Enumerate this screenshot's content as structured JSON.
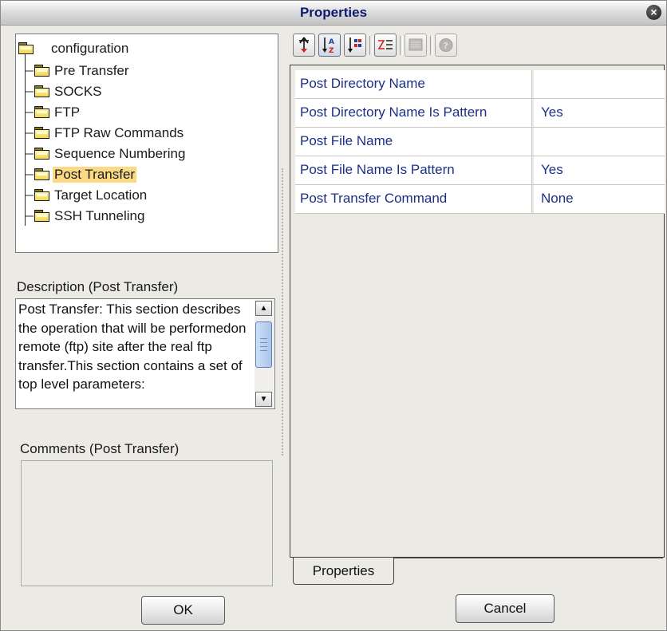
{
  "window": {
    "title": "Properties",
    "close_icon": "close-icon"
  },
  "tree": {
    "root": "configuration",
    "items": [
      {
        "label": "Pre Transfer"
      },
      {
        "label": "SOCKS"
      },
      {
        "label": "FTP"
      },
      {
        "label": "FTP Raw Commands"
      },
      {
        "label": "Sequence Numbering"
      },
      {
        "label": "Post Transfer",
        "selected": true
      },
      {
        "label": "Target Location"
      },
      {
        "label": "SSH Tunneling"
      }
    ]
  },
  "description": {
    "label": "Description (Post Transfer)",
    "text": "Post Transfer: This section describes the operation that will be performedon remote (ftp) site after the real ftp transfer.This section contains a set of top level parameters:"
  },
  "comments": {
    "label": "Comments (Post Transfer)",
    "text": ""
  },
  "toolbar": {
    "buttons": [
      {
        "icon": "sort-by-category-icon",
        "pressed": false
      },
      {
        "icon": "sort-alphabetically-icon",
        "pressed": true
      },
      {
        "icon": "sort-by-type-icon",
        "pressed": false
      },
      {
        "icon": "toggle-properties-icon",
        "pressed": false
      },
      {
        "icon": "edit-properties-icon",
        "disabled": true
      },
      {
        "icon": "help-icon",
        "disabled": true
      }
    ]
  },
  "properties": [
    {
      "name": "Post Directory Name",
      "value": ""
    },
    {
      "name": "Post Directory Name Is Pattern",
      "value": "Yes"
    },
    {
      "name": "Post File Name",
      "value": ""
    },
    {
      "name": "Post File Name Is Pattern",
      "value": "Yes"
    },
    {
      "name": "Post Transfer Command",
      "value": "None"
    }
  ],
  "tabs": {
    "properties": "Properties"
  },
  "buttons": {
    "ok": "OK",
    "cancel": "Cancel"
  },
  "colors": {
    "selection": "#fbd985",
    "property_text": "#1c2f86",
    "title_text": "#0c1a70"
  }
}
